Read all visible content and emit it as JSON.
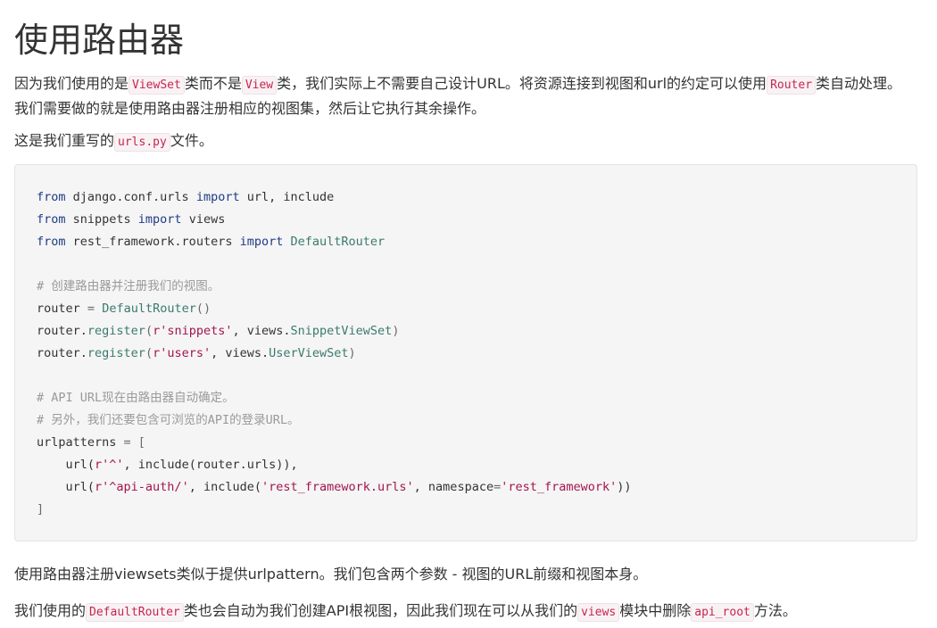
{
  "heading": "使用路由器",
  "para1": {
    "t1": "因为我们使用的是",
    "c1": "ViewSet",
    "t2": "类而不是",
    "c2": "View",
    "t3": "类，我们实际上不需要自己设计URL。将资源连接到视图和url的约定可以使用",
    "c3": "Router",
    "t4": "类自动处理。我们需要做的就是使用路由器注册相应的视图集，然后让它执行其余操作。"
  },
  "para2": {
    "t1": "这是我们重写的",
    "c1": "urls.py",
    "t2": "文件。"
  },
  "code": {
    "l1": {
      "k1": "from",
      "t1": " django.conf.urls ",
      "k2": "import",
      "t2": " url, include"
    },
    "l2": {
      "k1": "from",
      "t1": " snippets ",
      "k2": "import",
      "t2": " views"
    },
    "l3": {
      "k1": "from",
      "t1": " rest_framework.routers ",
      "k2": "import",
      "t2": " ",
      "c1": "DefaultRouter"
    },
    "l5": "# 创建路由器并注册我们的视图。",
    "l6": {
      "t1": "router ",
      "o1": "=",
      "t2": " ",
      "c1": "DefaultRouter",
      "o2": "()"
    },
    "l7": {
      "t1": "router.",
      "c1": "register",
      "o1": "(",
      "s1": "r'snippets'",
      "t2": ", views.",
      "c2": "SnippetViewSet",
      "o2": ")"
    },
    "l8": {
      "t1": "router.",
      "c1": "register",
      "o1": "(",
      "s1": "r'users'",
      "t2": ", views.",
      "c2": "UserViewSet",
      "o2": ")"
    },
    "l10": "# API URL现在由路由器自动确定。",
    "l11": "# 另外，我们还要包含可浏览的API的登录URL。",
    "l12": {
      "t1": "urlpatterns ",
      "o1": "= ["
    },
    "l13": {
      "t1": "    url(",
      "s1": "r'^'",
      "t2": ", include(router.urls)),"
    },
    "l14": {
      "t1": "    url(",
      "s1": "r'^api-auth/'",
      "t2": ", include(",
      "s2": "'rest_framework.urls'",
      "t3": ", namespace",
      "o1": "=",
      "s3": "'rest_framework'",
      "t4": "))"
    },
    "l15": "]"
  },
  "para3": "使用路由器注册viewsets类似于提供urlpattern。我们包含两个参数 - 视图的URL前缀和视图本身。",
  "para4": {
    "t1": "我们使用的",
    "c1": "DefaultRouter",
    "t2": "类也会自动为我们创建API根视图，因此我们现在可以从我们的",
    "c2": "views",
    "t3": "模块中删除",
    "c3": "api_root",
    "t4": "方法。"
  }
}
